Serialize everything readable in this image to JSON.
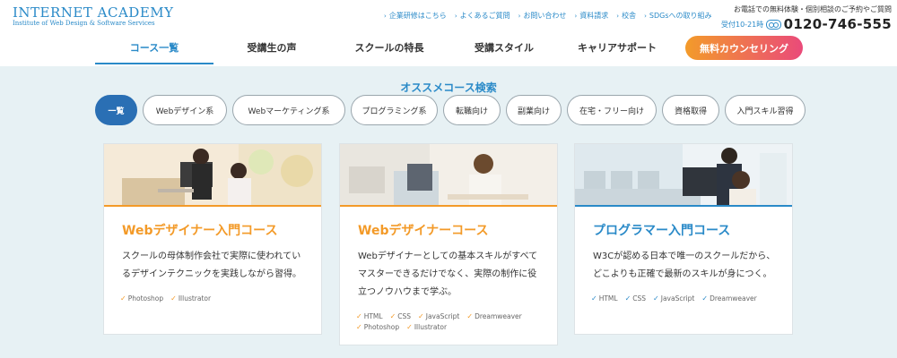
{
  "header": {
    "logo_main": "INTERNET ACADEMY",
    "logo_sub": "Institute of Web Design & Software Services",
    "utility_links": [
      "企業研修はこちら",
      "よくあるご質問",
      "お問い合わせ",
      "資料請求",
      "校舎",
      "SDGsへの取り組み"
    ],
    "phone_note": "お電話での無料体験・個別相談のご予約やご質問",
    "phone_hours": "受付10-21時",
    "phone_number": "0120-746-555"
  },
  "nav": {
    "items": [
      "コース一覧",
      "受講生の声",
      "スクールの特長",
      "受講スタイル",
      "キャリアサポート"
    ],
    "active_index": 0,
    "cta": "無料カウンセリング"
  },
  "search": {
    "title": "オススメコース検索",
    "filters": [
      "一覧",
      "Webデザイン系",
      "Webマーケティング系",
      "プログラミング系",
      "転職向け",
      "副業向け",
      "在宅・フリー向け",
      "資格取得",
      "入門スキル習得"
    ]
  },
  "courses": [
    {
      "title": "Webデザイナー入門コース",
      "title_color": "#f39a28",
      "desc": "スクールの母体制作会社で実際に使われているデザインテクニックを実践しながら習得。",
      "tags": [
        "Photoshop",
        "Illustrator"
      ]
    },
    {
      "title": "Webデザイナーコース",
      "title_color": "#f39a28",
      "desc": "Webデザイナーとしての基本スキルがすべてマスターできるだけでなく、実際の制作に役立つノウハウまで学ぶ。",
      "tags": [
        "HTML",
        "CSS",
        "JavaScript",
        "Dreamweaver",
        "Photoshop",
        "Illustrator"
      ]
    },
    {
      "title": "プログラマー入門コース",
      "title_color": "#2a8ac8",
      "desc": "W3Cが認める日本で唯一のスクールだから、どこよりも正確で最新のスキルが身につく。",
      "tags": [
        "HTML",
        "CSS",
        "JavaScript",
        "Dreamweaver"
      ]
    }
  ],
  "colors": {
    "brand_blue": "#2a8ac8",
    "active_pill": "#2a6fb4",
    "orange": "#f39a28",
    "cta_gradient": [
      "#f39b2a",
      "#ea4a7a"
    ]
  }
}
